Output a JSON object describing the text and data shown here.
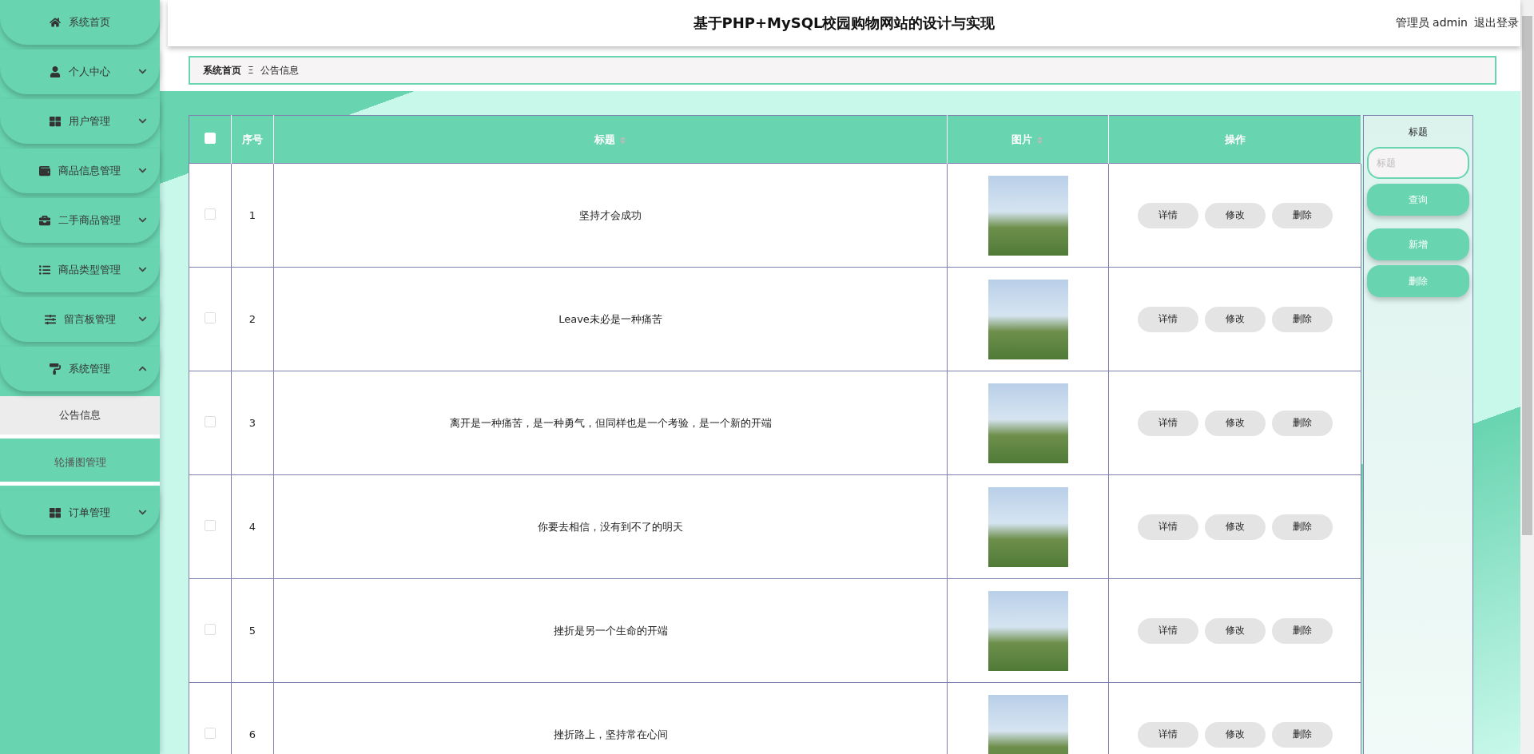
{
  "sidebar": {
    "items": [
      {
        "kind": "link",
        "label": "系统首页"
      },
      {
        "kind": "menu",
        "label": "个人中心",
        "expanded": false
      },
      {
        "kind": "menu",
        "label": "用户管理",
        "expanded": false
      },
      {
        "kind": "menu",
        "label": "商品信息管理",
        "expanded": false
      },
      {
        "kind": "menu",
        "label": "二手商品管理",
        "expanded": false
      },
      {
        "kind": "menu",
        "label": "商品类型管理",
        "expanded": false
      },
      {
        "kind": "menu",
        "label": "留言板管理",
        "expanded": false
      },
      {
        "kind": "menu",
        "label": "系统管理",
        "expanded": true,
        "children": [
          {
            "label": "公告信息",
            "selected": true
          },
          {
            "label": "轮播图管理",
            "selected": false
          }
        ]
      },
      {
        "kind": "menu",
        "label": "订单管理",
        "expanded": false
      }
    ]
  },
  "header": {
    "title": "基于PHP+MySQL校园购物网站的设计与实现",
    "user": "管理员 admin",
    "logout": "退出登录"
  },
  "breadcrumb": {
    "items": [
      "系统首页",
      "公告信息"
    ],
    "separator": "Ξ"
  },
  "table": {
    "select_all_checked": false,
    "columns": [
      {
        "label": "序号",
        "sortable": false
      },
      {
        "label": "标题",
        "sortable": true
      },
      {
        "label": "图片",
        "sortable": true
      },
      {
        "label": "操作",
        "sortable": false
      }
    ],
    "rows": [
      {
        "checked": false,
        "index": "1",
        "title": "坚持才会成功",
        "actions": [
          "详情",
          "修改",
          "删除"
        ]
      },
      {
        "checked": false,
        "index": "2",
        "title": "Leave未必是一种痛苦",
        "actions": [
          "详情",
          "修改",
          "删除"
        ]
      },
      {
        "checked": false,
        "index": "3",
        "title": "离开是一种痛苦，是一种勇气，但同样也是一个考验，是一个新的开端",
        "actions": [
          "详情",
          "修改",
          "删除"
        ]
      },
      {
        "checked": false,
        "index": "4",
        "title": "你要去相信，没有到不了的明天",
        "actions": [
          "详情",
          "修改",
          "删除"
        ]
      },
      {
        "checked": false,
        "index": "5",
        "title": "挫折是另一个生命的开端",
        "actions": [
          "详情",
          "修改",
          "删除"
        ]
      },
      {
        "checked": false,
        "index": "6",
        "title": "挫折路上，坚持常在心间",
        "actions": [
          "详情",
          "修改",
          "删除"
        ]
      }
    ]
  },
  "search_panel": {
    "label": "标题",
    "placeholder": "标题",
    "buttons": [
      {
        "kind": "query",
        "label": "查询"
      },
      {
        "kind": "add",
        "label": "新增"
      },
      {
        "kind": "delete",
        "label": "删除"
      }
    ]
  }
}
